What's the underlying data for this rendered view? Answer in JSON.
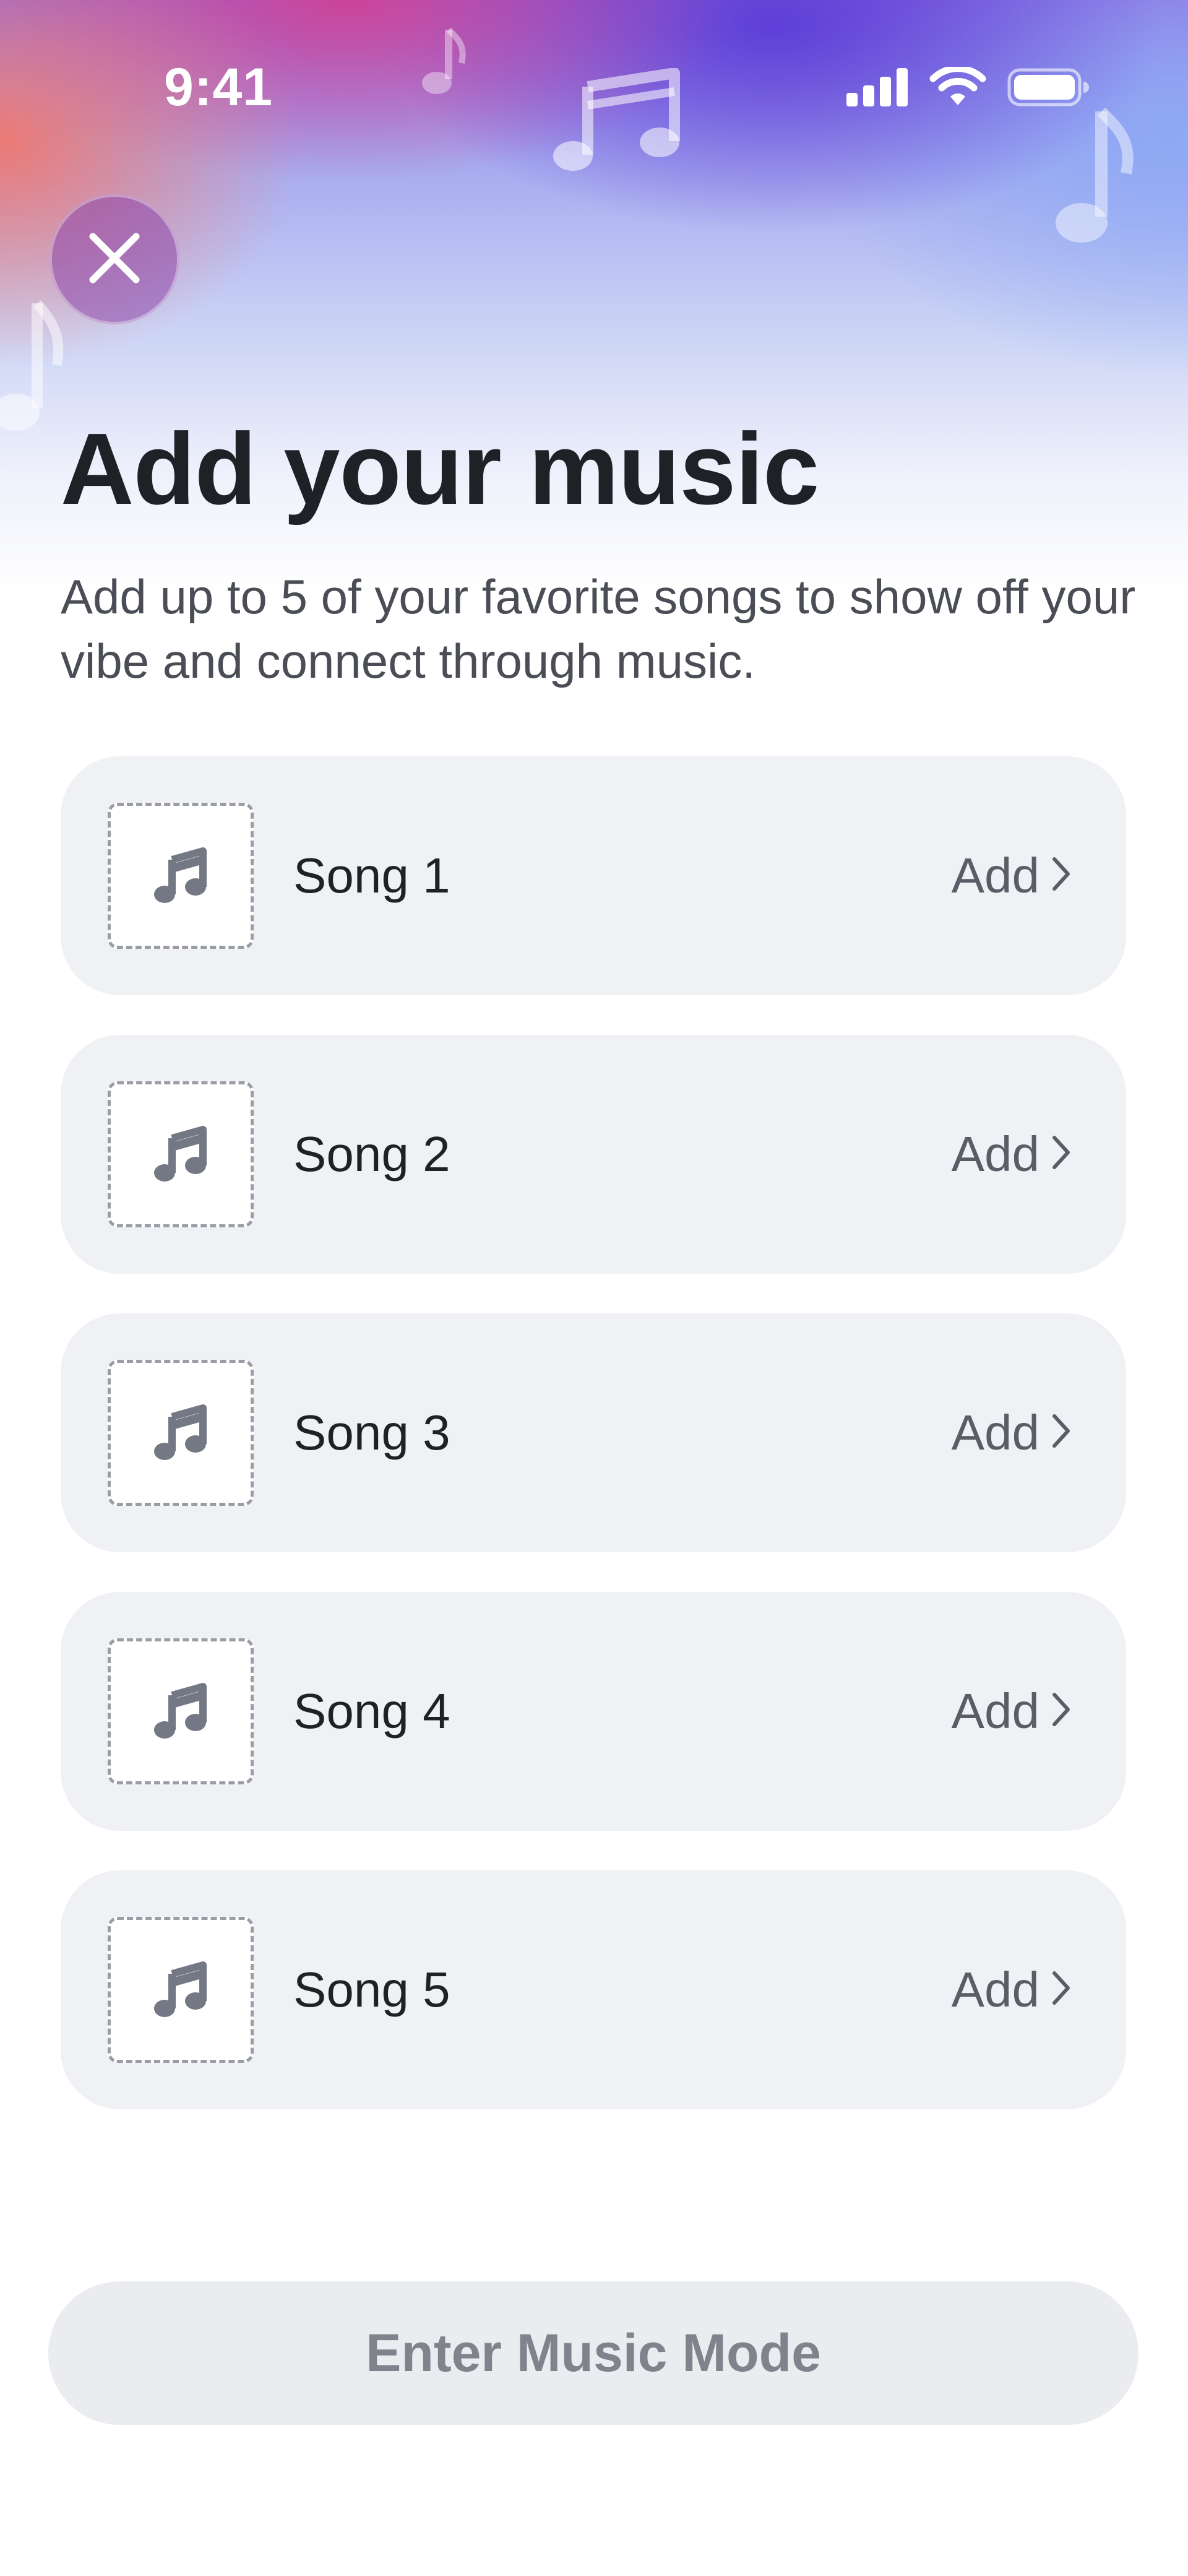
{
  "status_bar": {
    "time": "9:41",
    "icons": [
      "cellular-signal-icon",
      "wifi-icon",
      "battery-icon"
    ]
  },
  "header": {
    "close_icon": "close-icon",
    "title": "Add your music",
    "subtitle": "Add up to 5 of your favorite songs to show off your vibe and connect through music."
  },
  "songs": [
    {
      "label": "Song 1",
      "action": "Add",
      "art_icon": "music-note-icon",
      "action_icon": "chevron-right-icon"
    },
    {
      "label": "Song 2",
      "action": "Add",
      "art_icon": "music-note-icon",
      "action_icon": "chevron-right-icon"
    },
    {
      "label": "Song 3",
      "action": "Add",
      "art_icon": "music-note-icon",
      "action_icon": "chevron-right-icon"
    },
    {
      "label": "Song 4",
      "action": "Add",
      "art_icon": "music-note-icon",
      "action_icon": "chevron-right-icon"
    },
    {
      "label": "Song 5",
      "action": "Add",
      "art_icon": "music-note-icon",
      "action_icon": "chevron-right-icon"
    }
  ],
  "cta": {
    "label": "Enter Music Mode",
    "state": "disabled"
  },
  "colors": {
    "title_text": "#1f2127",
    "subtitle_text": "#4a4d55",
    "row_background": "#f0f1f4",
    "button_background": "#ebecef",
    "button_text": "#80838c",
    "gradient_pink": "#d73c8c",
    "gradient_purple": "#5a3cd7",
    "gradient_blue": "#8caaf5"
  }
}
